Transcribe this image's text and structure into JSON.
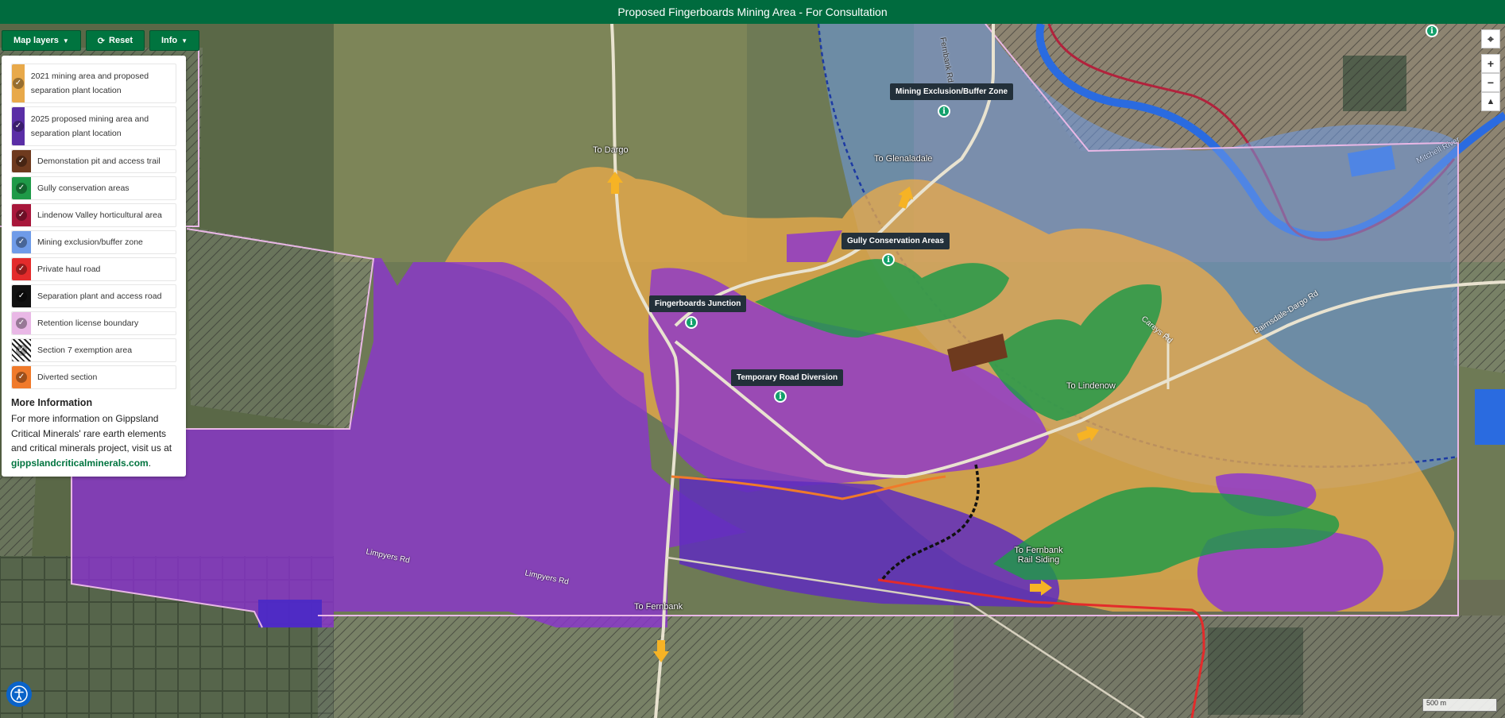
{
  "header": {
    "title": "Proposed Fingerboards Mining Area - For Consultation"
  },
  "toolbar": {
    "layers_label": "Map layers",
    "reset_label": "Reset",
    "info_label": "Info"
  },
  "legend": {
    "items": [
      {
        "label": "2021 mining area and proposed separation plant location",
        "color": "#e8a94a"
      },
      {
        "label": "2025 proposed mining area and separation plant location",
        "color": "#5a2ea6"
      },
      {
        "label": "Demonstation pit and access trail",
        "color": "#6e3a1e"
      },
      {
        "label": "Gully conservation areas",
        "color": "#1f9a48"
      },
      {
        "label": "Lindenow Valley horticultural area",
        "color": "#a8173b"
      },
      {
        "label": "Mining exclusion/buffer zone",
        "color": "#6f9be8"
      },
      {
        "label": "Private haul road",
        "color": "#e32b2b"
      },
      {
        "label": "Separation plant and access road",
        "color": "#111111"
      },
      {
        "label": "Retention license boundary",
        "color": "#e9b8e6"
      },
      {
        "label": "Section 7 exemption area",
        "color": "hatch"
      },
      {
        "label": "Diverted section",
        "color": "#f07a2a"
      }
    ],
    "more_title": "More Information",
    "more_text": "For more information on Gippsland Critical Minerals' rare earth elements and critical minerals project, visit us at",
    "more_link": "gippslandcriticalminerals.com",
    "more_end": "."
  },
  "map": {
    "labels": {
      "exclusion": "Mining Exclusion/Buffer Zone",
      "gully": "Gully Conservation Areas",
      "junction": "Fingerboards Junction",
      "diversion": "Temporary Road Diversion"
    },
    "places": {
      "dargo": "To Dargo",
      "glenaladale": "To Glenaladale",
      "lindenow": "To Lindenow",
      "fernbank_siding": "To Fernbank Rail Siding",
      "fernbank": "To Fernbank"
    },
    "roads": {
      "limpyers1": "Limpyers Rd",
      "limpyers2": "Limpyers Rd",
      "bairnsdale": "Bairnsdale-Dargo Rd",
      "careys": "Careys Rd",
      "mitchell": "Mitchell River",
      "fernbank_rd": "Fernbank Rd"
    },
    "scale_label": "500 m"
  },
  "colors": {
    "brand": "#006b3e",
    "marker": "#12a06b"
  }
}
